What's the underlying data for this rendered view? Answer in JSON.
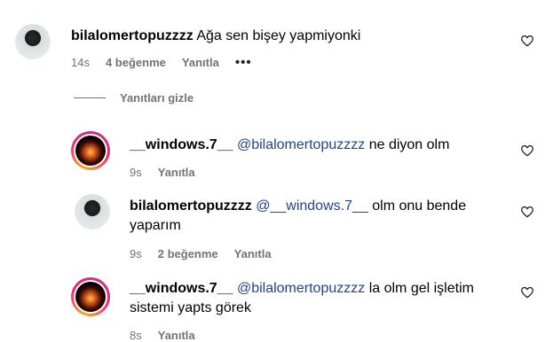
{
  "comments": [
    {
      "username": "bilalomertopuzzzz",
      "mention": "",
      "text": "Ağa sen bişey yapmiyonki",
      "time": "14s",
      "likes": "4 beğenme",
      "reply": "Yanıtla",
      "more": "•••",
      "avatar": "plain"
    },
    {
      "username": "__windows.7__",
      "mention": "@bilalomertopuzzzz",
      "text": "ne diyon olm",
      "time": "9s",
      "likes": "",
      "reply": "Yanıtla",
      "avatar": "ring"
    },
    {
      "username": "bilalomertopuzzzz",
      "mention": "@__windows.7__",
      "text": "olm onu bende",
      "text2": "yaparım",
      "time": "9s",
      "likes": "2 beğenme",
      "reply": "Yanıtla",
      "avatar": "plain"
    },
    {
      "username": "__windows.7__",
      "mention": "@bilalomertopuzzzz",
      "text": "la olm gel işletim",
      "text2": "sistemi yapts görek",
      "time": "8s",
      "likes": "",
      "reply": "Yanıtla",
      "avatar": "ring"
    }
  ],
  "hide_replies_label": "Yanıtları gizle",
  "icons": {
    "like": "heart-icon",
    "more": "more-options-icon"
  }
}
